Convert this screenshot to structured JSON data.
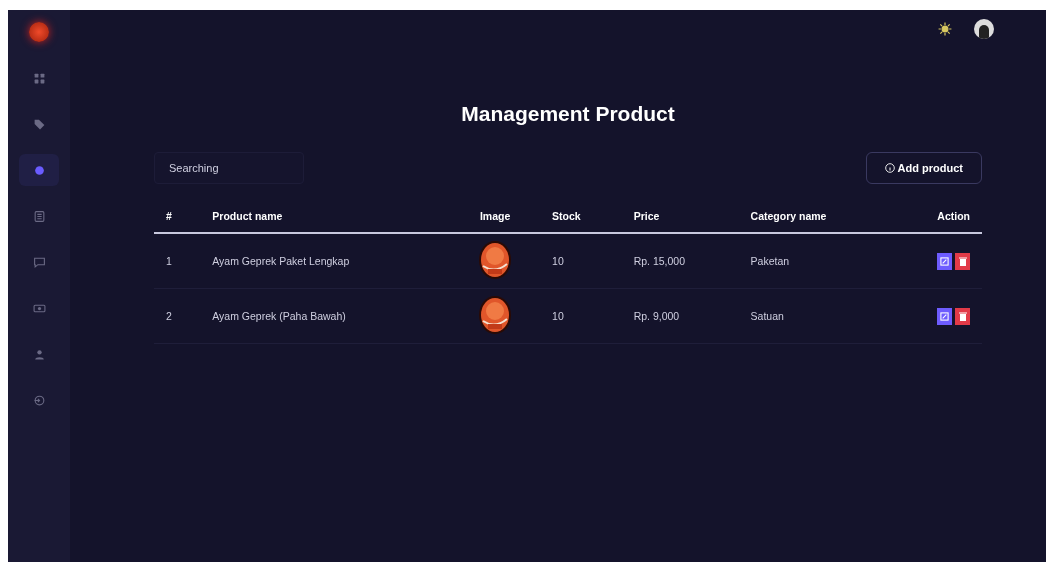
{
  "sidebar": {
    "items": [
      {
        "selected": false
      },
      {
        "selected": false
      },
      {
        "selected": true
      },
      {
        "selected": false
      },
      {
        "selected": false
      },
      {
        "selected": false
      },
      {
        "selected": false
      },
      {
        "selected": false
      }
    ]
  },
  "page": {
    "title": "Management Product"
  },
  "search": {
    "placeholder": "Searching"
  },
  "add_button": {
    "label": "Add product"
  },
  "table": {
    "columns": [
      "#",
      "Product name",
      "Image",
      "Stock",
      "Price",
      "Category name",
      "Action"
    ],
    "rows": [
      {
        "number": "1",
        "name": "Ayam Geprek Paket Lengkap",
        "stock": "10",
        "price": "Rp. 15,000",
        "category": "Paketan"
      },
      {
        "number": "2",
        "name": "Ayam Geprek (Paha Bawah)",
        "stock": "10",
        "price": "Rp. 9,000",
        "category": "Satuan"
      }
    ]
  }
}
